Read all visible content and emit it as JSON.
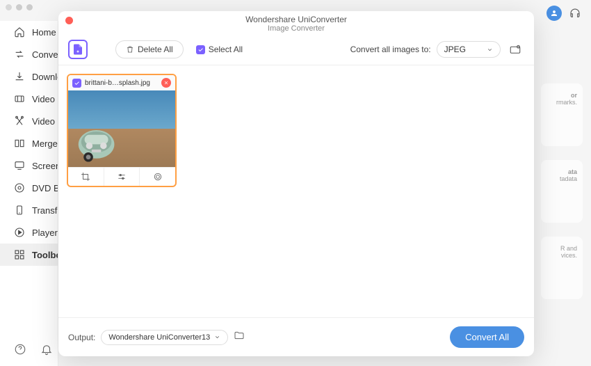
{
  "window": {
    "title": "Wondershare UniConverter"
  },
  "modal": {
    "title": "Wondershare UniConverter",
    "subtitle": "Image Converter",
    "toolbar": {
      "delete_label": "Delete All",
      "select_all_label": "Select All",
      "convert_to_label": "Convert all images to:",
      "format_value": "JPEG"
    },
    "file": {
      "name": "brittani-b…splash.jpg",
      "checked": true
    },
    "output": {
      "label": "Output:",
      "path": "Wondershare UniConverter13"
    },
    "convert_btn": "Convert All"
  },
  "sidebar": {
    "items": [
      {
        "label": "Home"
      },
      {
        "label": "Convert"
      },
      {
        "label": "Download"
      },
      {
        "label": "Video Compressor"
      },
      {
        "label": "Video Editor"
      },
      {
        "label": "Merger"
      },
      {
        "label": "Screen Recorder"
      },
      {
        "label": "DVD Burner"
      },
      {
        "label": "Transfer"
      },
      {
        "label": "Player"
      },
      {
        "label": "Toolbox"
      }
    ]
  },
  "bg": {
    "card1_title": "or",
    "card1_text": "rmarks.",
    "card2_title": "ata",
    "card2_text": "tadata",
    "card3_text1": "R and",
    "card3_text2": "vices."
  }
}
